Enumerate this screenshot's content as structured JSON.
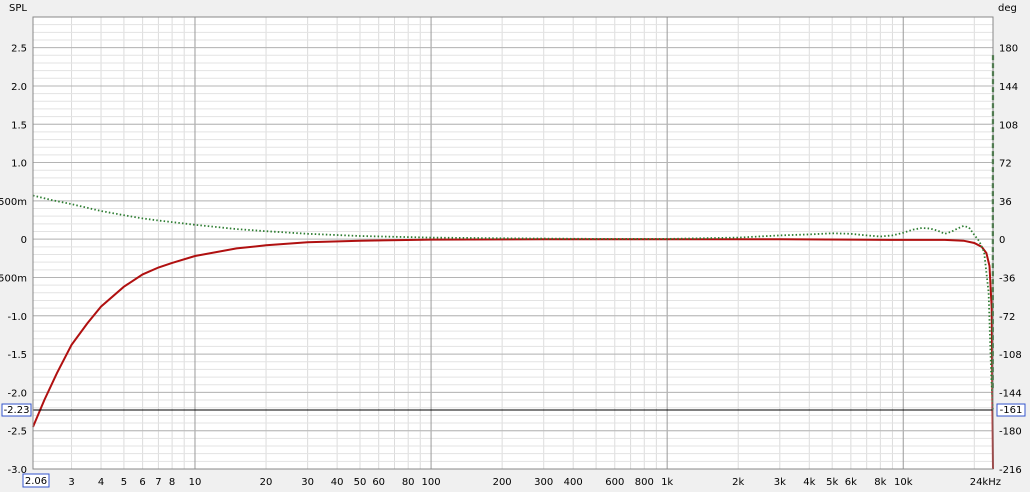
{
  "chart_data": {
    "type": "line",
    "left_unit": "SPL",
    "right_unit": "deg",
    "x_scale": "log",
    "x_range": [
      2.06,
      24000
    ],
    "y_left_range": [
      -3.0,
      2.9
    ],
    "y_right_range": [
      -216,
      208.8
    ],
    "x_tick_labels": [
      {
        "value": 3,
        "label": "3"
      },
      {
        "value": 4,
        "label": "4"
      },
      {
        "value": 5,
        "label": "5"
      },
      {
        "value": 6,
        "label": "6"
      },
      {
        "value": 7,
        "label": "7"
      },
      {
        "value": 8,
        "label": "8"
      },
      {
        "value": 10,
        "label": "10"
      },
      {
        "value": 20,
        "label": "20"
      },
      {
        "value": 30,
        "label": "30"
      },
      {
        "value": 40,
        "label": "40"
      },
      {
        "value": 50,
        "label": "50"
      },
      {
        "value": 60,
        "label": "60"
      },
      {
        "value": 80,
        "label": "80"
      },
      {
        "value": 100,
        "label": "100"
      },
      {
        "value": 200,
        "label": "200"
      },
      {
        "value": 300,
        "label": "300"
      },
      {
        "value": 400,
        "label": "400"
      },
      {
        "value": 600,
        "label": "600"
      },
      {
        "value": 800,
        "label": "800"
      },
      {
        "value": 1000,
        "label": "1k"
      },
      {
        "value": 2000,
        "label": "2k"
      },
      {
        "value": 3000,
        "label": "3k"
      },
      {
        "value": 4000,
        "label": "4k"
      },
      {
        "value": 5000,
        "label": "5k"
      },
      {
        "value": 6000,
        "label": "6k"
      },
      {
        "value": 8000,
        "label": "8k"
      },
      {
        "value": 10000,
        "label": "10k"
      },
      {
        "value": 24000,
        "label": "24kHz"
      }
    ],
    "y_left_ticks": [
      {
        "value": 2.5,
        "label": "2.5"
      },
      {
        "value": 2.0,
        "label": "2.0"
      },
      {
        "value": 1.5,
        "label": "1.5"
      },
      {
        "value": 1.0,
        "label": "1.0"
      },
      {
        "value": 0.5,
        "label": "500m"
      },
      {
        "value": 0,
        "label": "0"
      },
      {
        "value": -0.5,
        "label": "-500m"
      },
      {
        "value": -1.0,
        "label": "-1.0"
      },
      {
        "value": -1.5,
        "label": "-1.5"
      },
      {
        "value": -2.0,
        "label": "-2.0"
      },
      {
        "value": -2.5,
        "label": "-2.5"
      },
      {
        "value": -3.0,
        "label": "-3.0"
      }
    ],
    "y_right_ticks": [
      {
        "value": 180,
        "label": "180"
      },
      {
        "value": 144,
        "label": "144"
      },
      {
        "value": 108,
        "label": "108"
      },
      {
        "value": 72,
        "label": "72"
      },
      {
        "value": 36,
        "label": "36"
      },
      {
        "value": 0,
        "label": "0"
      },
      {
        "value": -36,
        "label": "-36"
      },
      {
        "value": -72,
        "label": "-72"
      },
      {
        "value": -108,
        "label": "-108"
      },
      {
        "value": -144,
        "label": "-144"
      },
      {
        "value": -180,
        "label": "-180"
      },
      {
        "value": -216,
        "label": "-216"
      }
    ],
    "cursor": {
      "x_label": "2.06",
      "y_left_label": "-2.23",
      "y_right_label": "-161",
      "y_value": -2.23
    },
    "grid": true,
    "series": [
      {
        "axis": "left",
        "style": "solid",
        "color": "#b01010",
        "points": [
          [
            2.06,
            -2.45
          ],
          [
            2.3,
            -2.1
          ],
          [
            2.6,
            -1.75
          ],
          [
            3,
            -1.38
          ],
          [
            3.5,
            -1.1
          ],
          [
            4,
            -0.88
          ],
          [
            5,
            -0.62
          ],
          [
            6,
            -0.46
          ],
          [
            7,
            -0.37
          ],
          [
            8,
            -0.31
          ],
          [
            10,
            -0.22
          ],
          [
            15,
            -0.12
          ],
          [
            20,
            -0.08
          ],
          [
            30,
            -0.04
          ],
          [
            50,
            -0.02
          ],
          [
            100,
            -0.005
          ],
          [
            300,
            0
          ],
          [
            1000,
            0
          ],
          [
            3000,
            0
          ],
          [
            6000,
            -0.005
          ],
          [
            10000,
            -0.01
          ],
          [
            15000,
            -0.01
          ],
          [
            18000,
            -0.02
          ],
          [
            20000,
            -0.05
          ],
          [
            21500,
            -0.1
          ],
          [
            22500,
            -0.18
          ],
          [
            23200,
            -0.35
          ],
          [
            23700,
            -0.9
          ],
          [
            24000,
            -3.0
          ]
        ]
      },
      {
        "axis": "right",
        "style": "dotted",
        "color": "#2e7d32",
        "points": [
          [
            2.06,
            41
          ],
          [
            2.5,
            36.5
          ],
          [
            3,
            33
          ],
          [
            3.5,
            29.5
          ],
          [
            4,
            26.5
          ],
          [
            5,
            22.5
          ],
          [
            6,
            19.5
          ],
          [
            7,
            17.5
          ],
          [
            8,
            16
          ],
          [
            10,
            13.5
          ],
          [
            15,
            9.5
          ],
          [
            20,
            7.5
          ],
          [
            30,
            5
          ],
          [
            50,
            3
          ],
          [
            100,
            1.5
          ],
          [
            200,
            0.8
          ],
          [
            500,
            0.3
          ],
          [
            1000,
            0.3
          ],
          [
            2000,
            1.5
          ],
          [
            3000,
            3.5
          ],
          [
            4000,
            4.5
          ],
          [
            5000,
            5.5
          ],
          [
            6000,
            5
          ],
          [
            7000,
            3.5
          ],
          [
            8000,
            2.5
          ],
          [
            9000,
            3.5
          ],
          [
            10000,
            6
          ],
          [
            11000,
            9
          ],
          [
            12000,
            10.5
          ],
          [
            13000,
            10
          ],
          [
            14000,
            8
          ],
          [
            15000,
            5
          ],
          [
            16000,
            7
          ],
          [
            17000,
            10
          ],
          [
            18000,
            12.5
          ],
          [
            19000,
            11
          ],
          [
            20000,
            4
          ],
          [
            21000,
            -2
          ],
          [
            22000,
            -12
          ],
          [
            23000,
            -50
          ],
          [
            23600,
            -130
          ],
          [
            24000,
            -161
          ]
        ]
      },
      {
        "axis": "right",
        "style": "dashed",
        "color": "#1a6e1a",
        "points": [
          [
            23950,
            -140
          ],
          [
            23975,
            20
          ],
          [
            24000,
            175
          ]
        ]
      }
    ]
  }
}
